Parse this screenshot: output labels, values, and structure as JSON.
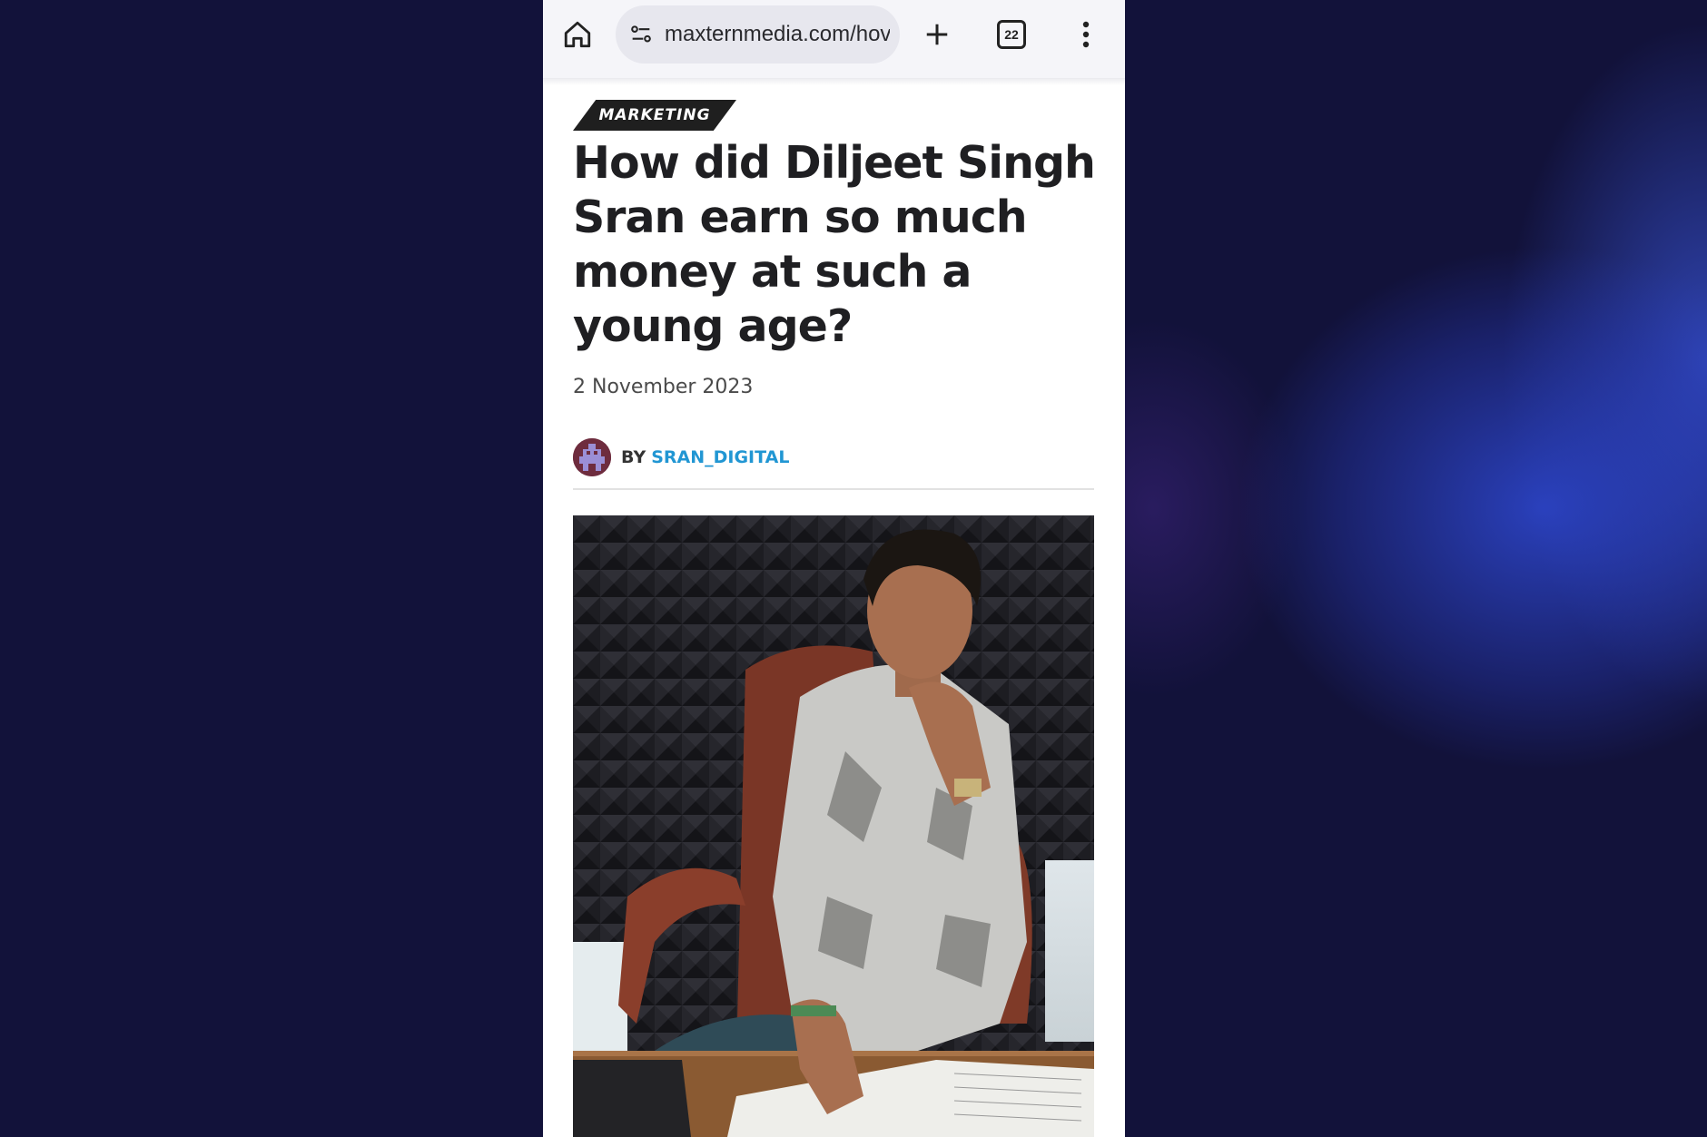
{
  "browser": {
    "url": "maxternmedia.com/hov",
    "tab_count": "22",
    "icons": {
      "home": "home-icon",
      "site_settings": "tune-icon",
      "new_tab": "plus-icon",
      "tabs": "tab-switcher-icon",
      "menu": "more-vert-icon"
    }
  },
  "article": {
    "category": "MARKETING",
    "title": "How did Diljeet Singh Sran earn so much money at such a young age?",
    "date": "2 November 2023",
    "by_label": "BY",
    "author": "SRAN_DIGITAL",
    "hero_image": "photo of a young man in a patterned shirt seated in a brown office chair at a desk with papers"
  },
  "colors": {
    "background": "#12123a",
    "glow": "#2e48d2",
    "author_link": "#2196d3",
    "category_badge": "#1f1f1f",
    "headline": "#1f1f22"
  }
}
